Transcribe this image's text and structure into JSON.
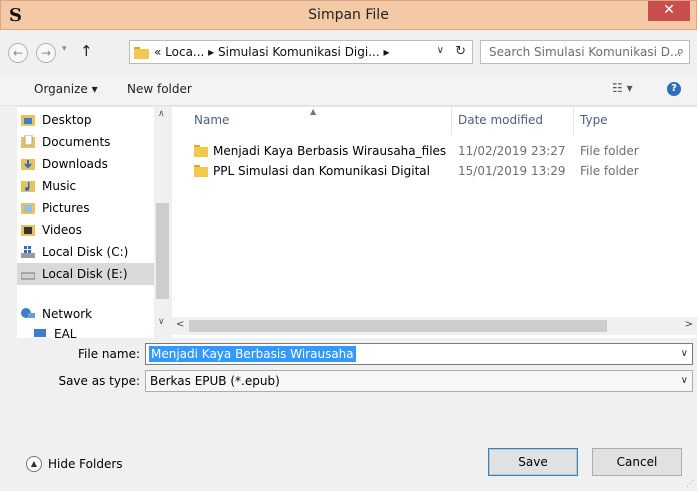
{
  "window": {
    "logo": "S",
    "title": "Simpan File",
    "close": "✕"
  },
  "nav": {
    "back": "←",
    "forward": "→",
    "up": "↑",
    "address": "« Loca... ▸ Simulasi Komunikasi Digi... ▸",
    "search_placeholder": "Search Simulasi Komunikasi D..."
  },
  "toolbar": {
    "organize": "Organize ▾",
    "new_folder": "New folder",
    "view": "☷ ▾",
    "help": "?"
  },
  "sidebar": {
    "items": [
      {
        "label": "Desktop",
        "icon": "desktop-folder-icon",
        "color": "#3c7ec9"
      },
      {
        "label": "Documents",
        "icon": "documents-folder-icon",
        "color": "#e8c25a"
      },
      {
        "label": "Downloads",
        "icon": "downloads-folder-icon",
        "color": "#3c7ec9"
      },
      {
        "label": "Music",
        "icon": "music-folder-icon",
        "color": "#e8c25a"
      },
      {
        "label": "Pictures",
        "icon": "pictures-folder-icon",
        "color": "#e8c25a"
      },
      {
        "label": "Videos",
        "icon": "videos-folder-icon",
        "color": "#e8c25a"
      },
      {
        "label": "Local Disk (C:)",
        "icon": "windows-drive-icon",
        "color": "#3c7ec9"
      },
      {
        "label": "Local Disk (E:)",
        "icon": "drive-icon",
        "color": "#9a9a9a"
      },
      {
        "label": "Network",
        "icon": "network-icon",
        "color": "#3c7ec9"
      },
      {
        "label": "EAL",
        "icon": "computer-icon",
        "color": "#3c7ec9"
      }
    ]
  },
  "files": {
    "columns": [
      "Name",
      "Date modified",
      "Type"
    ],
    "rows": [
      {
        "name": "Menjadi Kaya Berbasis Wirausaha_files",
        "date": "11/02/2019 23:27",
        "type": "File folder"
      },
      {
        "name": "PPL Simulasi dan Komunikasi Digital",
        "date": "15/01/2019 13:29",
        "type": "File folder"
      }
    ]
  },
  "form": {
    "filename_label": "File name:",
    "filename_value": "Menjadi Kaya Berbasis Wirausaha",
    "savetype_label": "Save as type:",
    "savetype_value": "Berkas EPUB (*.epub)"
  },
  "footer": {
    "hide_folders": "Hide Folders",
    "save": "Save",
    "cancel": "Cancel"
  }
}
